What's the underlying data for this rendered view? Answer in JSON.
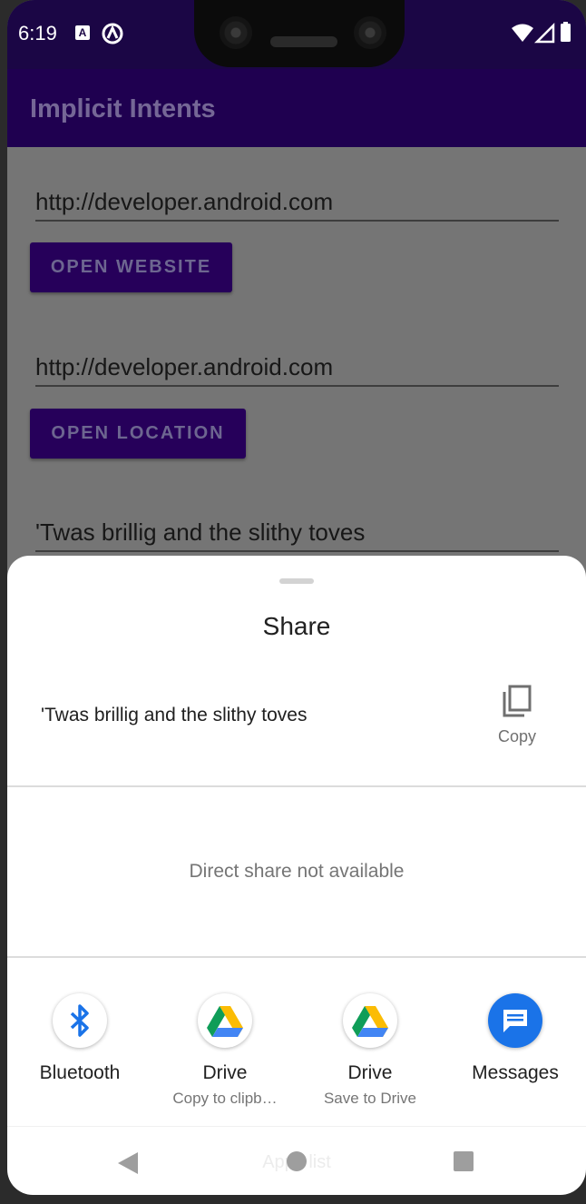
{
  "status_bar": {
    "time": "6:19",
    "left_icons": [
      "a-box-icon",
      "circle-a-icon"
    ],
    "right_icons": [
      "wifi-icon",
      "signal-icon",
      "battery-icon"
    ]
  },
  "app_bar": {
    "title": "Implicit Intents",
    "color": "#1f0050"
  },
  "main": {
    "website_field_value": "http://developer.android.com",
    "open_website_label": "OPEN WEBSITE",
    "location_field_value": "http://developer.android.com",
    "open_location_label": "OPEN LOCATION",
    "share_field_value": "'Twas brillig and the slithy toves"
  },
  "share_sheet": {
    "title": "Share",
    "preview_text": "'Twas brillig and the slithy toves",
    "copy_label": "Copy",
    "direct_share_text": "Direct share not available",
    "targets": [
      {
        "name": "Bluetooth",
        "subtitle": "",
        "icon": "bluetooth-icon"
      },
      {
        "name": "Drive",
        "subtitle": "Copy to clipb…",
        "icon": "google-drive-icon"
      },
      {
        "name": "Drive",
        "subtitle": "Save to Drive",
        "icon": "google-drive-icon"
      },
      {
        "name": "Messages",
        "subtitle": "",
        "icon": "messages-icon"
      }
    ],
    "overlay_faded_text": "Apps list"
  },
  "nav_bar": {
    "icons": [
      "back-icon",
      "home-icon",
      "recents-icon"
    ]
  }
}
